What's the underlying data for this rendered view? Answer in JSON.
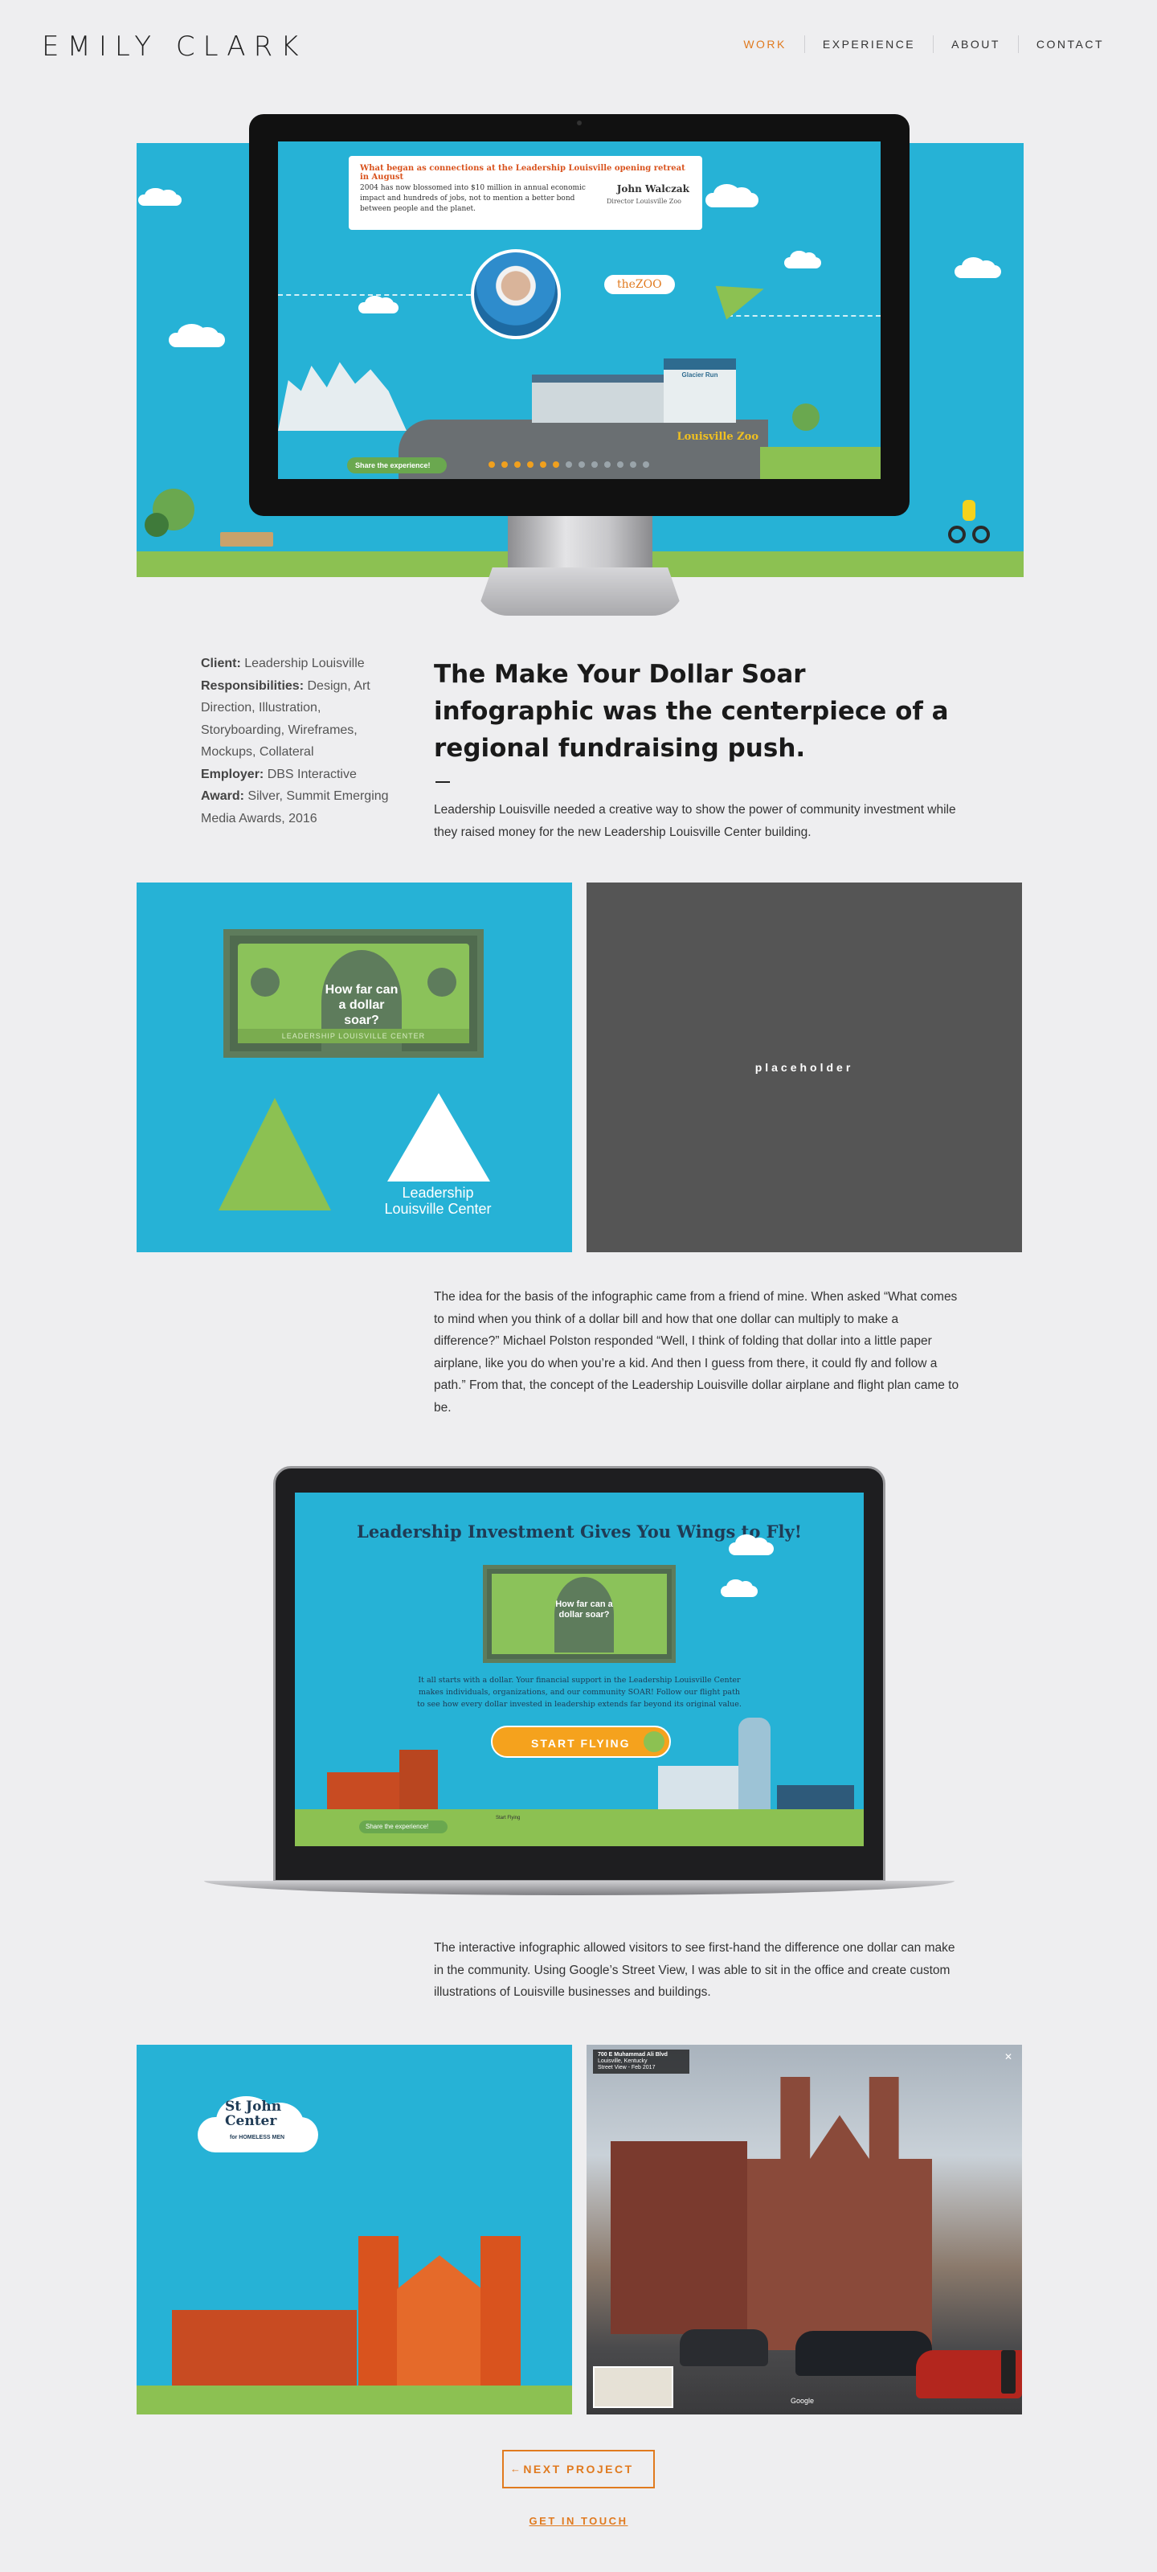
{
  "header": {
    "logo": "EMILY CLARK",
    "nav": [
      "WORK",
      "EXPERIENCE",
      "ABOUT",
      "CONTACT"
    ],
    "active_nav": "WORK"
  },
  "hero": {
    "quote_heading": "What began as connections at the Leadership Louisville opening retreat in August",
    "quote_body": "2004 has now blossomed into $10 million in annual economic impact and hundreds of jobs, not to mention a better bond between people and the planet.",
    "person_name": "John Walczak",
    "person_role": "Director Louisville Zoo",
    "zoo_badge": "theZOO",
    "zoo_label": "Louisville Zoo",
    "glacier_label": "Glacier Run",
    "share_label": "Share the experience!"
  },
  "meta": {
    "client_label": "Client:",
    "client": "Leadership Louisville",
    "responsibilities_label": "Responsibilities:",
    "responsibilities": "Design, Art Direction, Illustration, Storyboarding, Wireframes, Mockups, Collateral",
    "employer_label": "Employer:",
    "employer": "DBS Interactive",
    "award_label": "Award:",
    "award": "Silver, Summit Emerging Media Awards, 2016"
  },
  "headline": "The Make Your Dollar Soar infographic was the centerpiece of a regional fundraising push.",
  "intro": "Leadership Louisville needed a creative way to show the power of community investment while they raised money for the new Leadership Louisville Center building.",
  "panel_bill": {
    "bill_text": "How far can a dollar soar?",
    "strip_text": "LEADERSHIP LOUISVILLE CENTER",
    "llc_name": "Leadership Louisville Center"
  },
  "placeholder_text": "placeholder",
  "story": "The idea for the basis of the infographic came from a friend of mine. When asked “What comes to mind when you think of a dollar bill and how that one dollar can multiply to make a difference?” Michael Polston responded “Well, I think of folding that dollar into a little paper airplane, like you do when you’re a kid. And then I guess from there, it could fly and follow a path.” From that, the concept of the Leadership Louisville dollar airplane and flight plan came to be.",
  "laptop": {
    "title": "Leadership Investment Gives You Wings to Fly!",
    "bill_text": "How far can a dollar soar?",
    "blurb": "It all starts with a dollar. Your financial support in the Leadership Louisville Center makes individuals, organizations, and our community SOAR! Follow our flight path to see how every dollar invested in leadership extends far beyond its original value.",
    "start_label": "START FLYING",
    "share_label": "Share the experience!",
    "start_small": "Start Flying"
  },
  "interactive": "The interactive infographic allowed visitors to see first-hand the difference one dollar can make in the community. Using Google’s Street View, I was able to sit in the office and create custom illustrations of Louisville businesses and buildings.",
  "stjohn": {
    "name": "St John Center",
    "tagline": "for HOMELESS MEN"
  },
  "streetview": {
    "address": "700 E Muhammad Ali Blvd",
    "city": "Louisville, Kentucky",
    "date": "Street View - Feb 2017",
    "google": "Google"
  },
  "footer": {
    "next_label": "NEXT PROJECT",
    "next_arrow": "←",
    "touch_label": "GET IN TOUCH"
  }
}
